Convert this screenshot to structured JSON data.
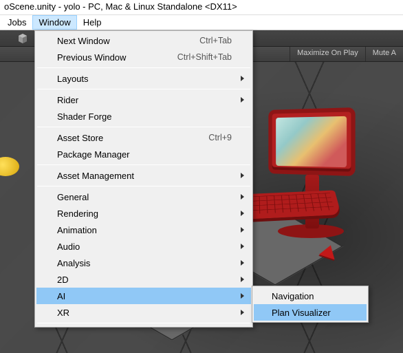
{
  "titlebar": "oScene.unity - yolo - PC, Mac & Linux Standalone <DX11>",
  "menubar": {
    "items": [
      "Jobs",
      "Window",
      "Help"
    ],
    "active_index": 1
  },
  "scene_toolbar": {
    "maximize": "Maximize On Play",
    "mute": "Mute A"
  },
  "dropdown": {
    "items": [
      {
        "label": "Next Window",
        "shortcut": "Ctrl+Tab"
      },
      {
        "label": "Previous Window",
        "shortcut": "Ctrl+Shift+Tab"
      },
      {
        "sep": true
      },
      {
        "label": "Layouts",
        "submenu": true
      },
      {
        "sep": true
      },
      {
        "label": "Rider",
        "submenu": true
      },
      {
        "label": "Shader Forge"
      },
      {
        "sep": true
      },
      {
        "label": "Asset Store",
        "shortcut": "Ctrl+9"
      },
      {
        "label": "Package Manager"
      },
      {
        "sep": true
      },
      {
        "label": "Asset Management",
        "submenu": true
      },
      {
        "sep": true
      },
      {
        "label": "General",
        "submenu": true
      },
      {
        "label": "Rendering",
        "submenu": true
      },
      {
        "label": "Animation",
        "submenu": true
      },
      {
        "label": "Audio",
        "submenu": true
      },
      {
        "label": "Analysis",
        "submenu": true
      },
      {
        "label": "2D",
        "submenu": true
      },
      {
        "label": "AI",
        "submenu": true,
        "highlight": true
      },
      {
        "label": "XR",
        "submenu": true
      },
      {
        "sep": true
      }
    ]
  },
  "submenu": {
    "items": [
      {
        "label": "Navigation"
      },
      {
        "label": "Plan Visualizer",
        "highlight": true
      }
    ]
  }
}
